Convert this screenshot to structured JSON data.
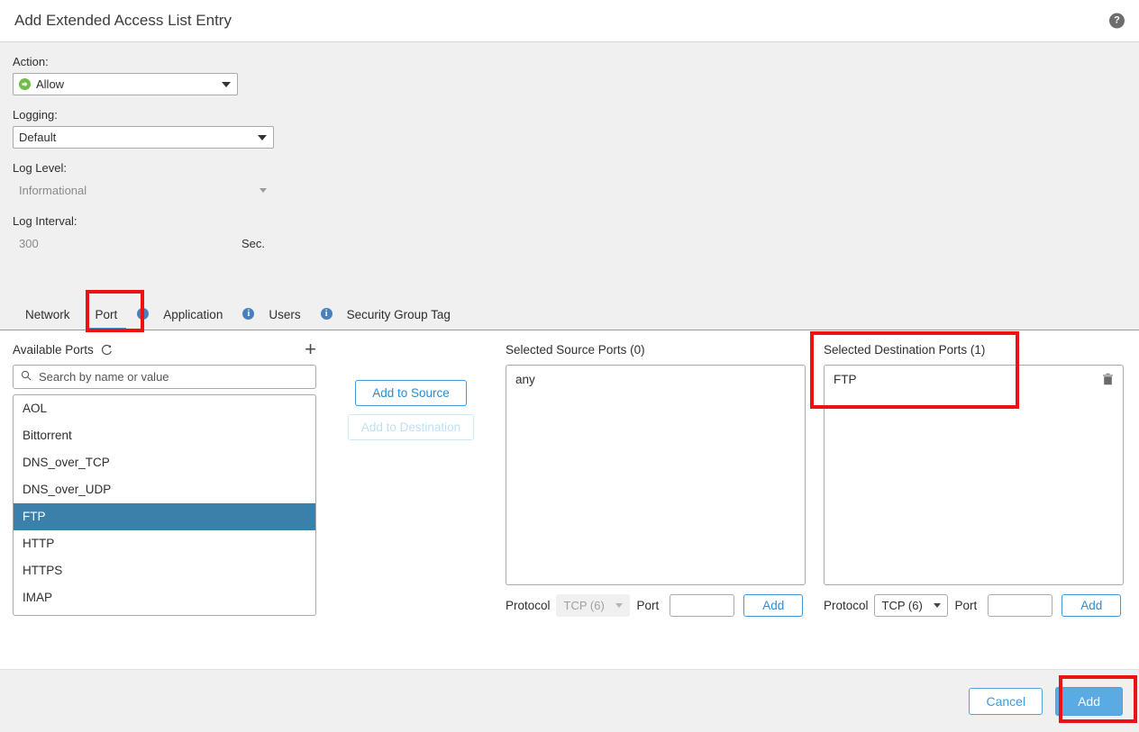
{
  "header": {
    "title": "Add Extended Access List Entry",
    "help_icon": "help-circle-icon",
    "help_glyph": "?"
  },
  "form": {
    "action": {
      "label": "Action:",
      "value": "Allow",
      "icon": "allow-arrow-icon"
    },
    "logging": {
      "label": "Logging:",
      "value": "Default"
    },
    "log_level": {
      "label": "Log Level:",
      "value": "Informational",
      "disabled": true
    },
    "log_interval": {
      "label": "Log Interval:",
      "value": "300",
      "unit": "Sec.",
      "disabled": true
    }
  },
  "tabs": [
    {
      "label": "Network",
      "active": false,
      "info": false
    },
    {
      "label": "Port",
      "active": true,
      "info": false
    },
    {
      "label": "Application",
      "active": false,
      "info": true
    },
    {
      "label": "Users",
      "active": false,
      "info": true
    },
    {
      "label": "Security Group Tag",
      "active": false,
      "info": true
    }
  ],
  "available": {
    "title": "Available Ports",
    "refresh_icon": "refresh-icon",
    "add_icon": "plus-icon",
    "search_placeholder": "Search by name or value",
    "search_value": "",
    "items": [
      {
        "label": "AOL",
        "selected": false
      },
      {
        "label": "Bittorrent",
        "selected": false
      },
      {
        "label": "DNS_over_TCP",
        "selected": false
      },
      {
        "label": "DNS_over_UDP",
        "selected": false
      },
      {
        "label": "FTP",
        "selected": true
      },
      {
        "label": "HTTP",
        "selected": false
      },
      {
        "label": "HTTPS",
        "selected": false
      },
      {
        "label": "IMAP",
        "selected": false
      }
    ]
  },
  "transfer": {
    "add_to_source": "Add to Source",
    "add_to_destination": "Add to Destination"
  },
  "source": {
    "title": "Selected Source Ports (0)",
    "items": [
      {
        "label": "any",
        "deletable": false
      }
    ],
    "protocol_label": "Protocol",
    "protocol_value": "TCP (6)",
    "protocol_disabled": true,
    "port_label": "Port",
    "port_value": "",
    "add_label": "Add"
  },
  "destination": {
    "title": "Selected Destination Ports (1)",
    "items": [
      {
        "label": "FTP",
        "deletable": true,
        "delete_icon": "trash-icon"
      }
    ],
    "protocol_label": "Protocol",
    "protocol_value": "TCP (6)",
    "protocol_disabled": false,
    "port_label": "Port",
    "port_value": "",
    "add_label": "Add"
  },
  "footer": {
    "cancel_label": "Cancel",
    "add_label": "Add"
  },
  "colors": {
    "accent_blue": "#3c9ae0",
    "primary_button": "#5aaae4",
    "selection_blue": "#3b7fab",
    "allow_green": "#6cbe45",
    "highlight_red": "#ee1111",
    "page_gray": "#f0f0f0"
  }
}
